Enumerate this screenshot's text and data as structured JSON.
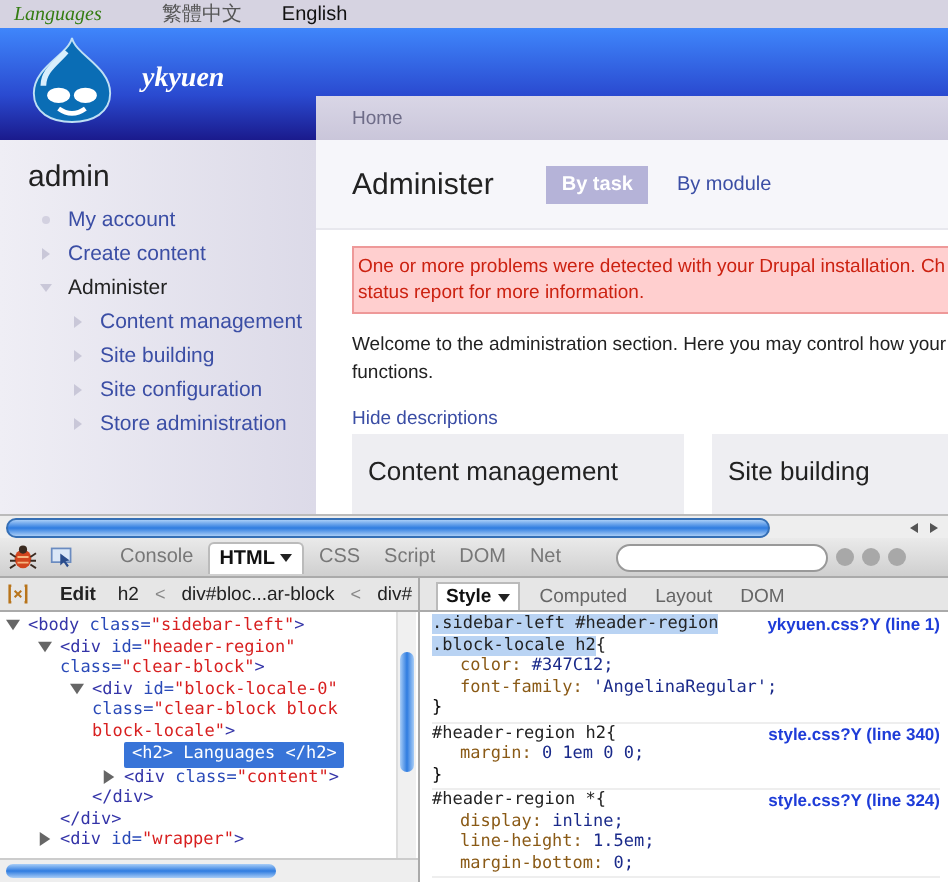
{
  "language_bar": {
    "title": "Languages",
    "links": [
      {
        "label": "繁體中文",
        "selected": false
      },
      {
        "label": "English",
        "selected": true
      }
    ]
  },
  "header": {
    "site_name": "ykyuen"
  },
  "sidebar": {
    "title": "admin",
    "items": [
      {
        "label": "My account",
        "kind": "leaf",
        "expanded": false
      },
      {
        "label": "Create content",
        "kind": "branch",
        "expanded": false
      },
      {
        "label": "Administer",
        "kind": "branch",
        "expanded": true,
        "children": [
          {
            "label": "Content management",
            "kind": "branch",
            "expanded": false
          },
          {
            "label": "Site building",
            "kind": "branch",
            "expanded": false
          },
          {
            "label": "Site configuration",
            "kind": "branch",
            "expanded": false
          },
          {
            "label": "Store administration",
            "kind": "branch",
            "expanded": false
          }
        ]
      }
    ]
  },
  "breadcrumb": [
    "Home"
  ],
  "content": {
    "title": "Administer",
    "tabs": [
      {
        "label": "By task",
        "selected": true
      },
      {
        "label": "By module",
        "selected": false
      }
    ],
    "error_lines": [
      "One or more problems were detected with your Drupal installation. Ch",
      "status report for more information."
    ],
    "intro_lines": [
      "Welcome to the administration section. Here you may control how your",
      "functions."
    ],
    "toggle_link": "Hide descriptions",
    "panels": [
      {
        "title": "Content management"
      },
      {
        "title": "Site building"
      }
    ]
  },
  "firebug": {
    "tabs": [
      {
        "label": "Console",
        "selected": false,
        "menu": false
      },
      {
        "label": "HTML",
        "selected": true,
        "menu": true
      },
      {
        "label": "CSS",
        "selected": false,
        "menu": false
      },
      {
        "label": "Script",
        "selected": false,
        "menu": false
      },
      {
        "label": "DOM",
        "selected": false,
        "menu": false
      },
      {
        "label": "Net",
        "selected": false,
        "menu": false
      }
    ],
    "path": [
      {
        "kind": "button",
        "text": "Edit"
      },
      {
        "kind": "node",
        "text": "h2"
      },
      {
        "kind": "separator",
        "text": "<"
      },
      {
        "kind": "node",
        "text": "div#bloc...ar-block"
      },
      {
        "kind": "separator",
        "text": "<"
      },
      {
        "kind": "node",
        "text": "div#"
      }
    ],
    "side_tabs": [
      {
        "label": "Style",
        "selected": true,
        "menu": true
      },
      {
        "label": "Computed",
        "selected": false,
        "menu": false
      },
      {
        "label": "Layout",
        "selected": false,
        "menu": false
      },
      {
        "label": "DOM",
        "selected": false,
        "menu": false
      }
    ],
    "html_tree": [
      {
        "kind": "element",
        "expanded": true,
        "selected": false,
        "segments": [
          {
            "kind": "tag",
            "text": "<body"
          },
          {
            "kind": "attr",
            "text": " class="
          },
          {
            "kind": "value",
            "text": "\"sidebar-left\""
          },
          {
            "kind": "tag",
            "text": ">"
          }
        ],
        "children": [
          {
            "kind": "element",
            "expanded": true,
            "selected": false,
            "segments": [
              {
                "kind": "tag",
                "text": "<div"
              },
              {
                "kind": "attr",
                "text": " id="
              },
              {
                "kind": "value",
                "text": "\"header-region\""
              },
              {
                "kind": "attr",
                "text": " class="
              },
              {
                "kind": "value",
                "text": "\"clear-block\""
              },
              {
                "kind": "tag",
                "text": ">"
              }
            ],
            "children": [
              {
                "kind": "element",
                "expanded": true,
                "selected": false,
                "segments": [
                  {
                    "kind": "tag",
                    "text": "<div"
                  },
                  {
                    "kind": "attr",
                    "text": " id="
                  },
                  {
                    "kind": "value",
                    "text": "\"block-locale-0\""
                  },
                  {
                    "kind": "attr",
                    "text": " class="
                  },
                  {
                    "kind": "value",
                    "text": "\"clear-block block block-locale\""
                  },
                  {
                    "kind": "tag",
                    "text": ">"
                  }
                ],
                "children": [
                  {
                    "kind": "leaf",
                    "selected": true,
                    "segments": [
                      {
                        "kind": "tag",
                        "text": "<h2>"
                      },
                      {
                        "kind": "text",
                        "text": " Languages "
                      },
                      {
                        "kind": "tag",
                        "text": "</h2>"
                      }
                    ]
                  },
                  {
                    "kind": "element",
                    "expanded": false,
                    "selected": false,
                    "segments": [
                      {
                        "kind": "tag",
                        "text": "<div"
                      },
                      {
                        "kind": "attr",
                        "text": " class="
                      },
                      {
                        "kind": "value",
                        "text": "\"content\""
                      },
                      {
                        "kind": "tag",
                        "text": ">"
                      }
                    ]
                  }
                ]
              },
              {
                "kind": "close",
                "selected": false,
                "segments": [
                  {
                    "kind": "tag",
                    "text": "</div>"
                  }
                ]
              }
            ]
          },
          {
            "kind": "close",
            "selected": false,
            "segments": [
              {
                "kind": "tag",
                "text": "</div>"
              }
            ]
          },
          {
            "kind": "element",
            "expanded": false,
            "selected": false,
            "segments": [
              {
                "kind": "tag",
                "text": "<div"
              },
              {
                "kind": "attr",
                "text": " id="
              },
              {
                "kind": "value",
                "text": "\"wrapper\""
              },
              {
                "kind": "tag",
                "text": ">"
              }
            ]
          }
        ]
      }
    ],
    "css_rules": [
      {
        "selector_lines": [
          ".sidebar-left #header-region",
          ".block-locale h2"
        ],
        "brace": "{",
        "selected": true,
        "source": "ykyuen.css?Y (line 1)",
        "declarations": [
          {
            "property": "color:",
            "value": "#347C12;"
          },
          {
            "property": "font-family:",
            "value": "'AngelinaRegular';"
          }
        ],
        "close": "}"
      },
      {
        "selector_lines": [
          "#header-region h2"
        ],
        "brace": "{",
        "selected": false,
        "source": "style.css?Y (line 340)",
        "declarations": [
          {
            "property": "margin:",
            "value": "0 1em 0 0;"
          }
        ],
        "close": "}"
      },
      {
        "selector_lines": [
          "#header-region *"
        ],
        "brace": "{",
        "selected": false,
        "source": "style.css?Y (line 324)",
        "declarations": [
          {
            "property": "display:",
            "value": "inline;"
          },
          {
            "property": "line-height:",
            "value": "1.5em;"
          },
          {
            "property": "margin-bottom:",
            "value": "0;"
          }
        ]
      }
    ]
  }
}
